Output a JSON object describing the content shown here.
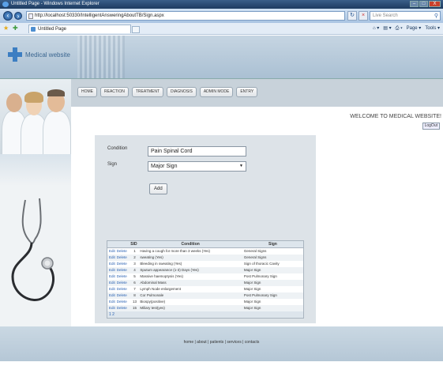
{
  "window": {
    "title": "Untitled Page - Windows Internet Explorer",
    "minimize": "–",
    "maximize": "□",
    "close": "X"
  },
  "addressbar": {
    "url": "http://localhost:50330/IntelligentAnsweringAboutTB/Sign.aspx",
    "search_placeholder": "Live Search"
  },
  "tabs": [
    {
      "label": "Untitled Page"
    }
  ],
  "commandbar": {
    "items": [
      "⌂ ▾",
      "▤ ▾",
      "⎙ ▾",
      "Page ▾",
      "Tools ▾"
    ]
  },
  "site": {
    "logo_text": "Medical website",
    "nav": [
      "HOME",
      "REACTION",
      "TREATMENT",
      "DIAGNOSIS",
      "ADMIN MODE",
      "ENTRY"
    ],
    "welcome": "WELCOME TO MEDICAL WEBSITE!",
    "logout": "LogOut"
  },
  "form": {
    "condition_label": "Condition",
    "condition_value": "Pain Spinal Cord",
    "sign_label": "Sign",
    "sign_value": "Major Sign",
    "add_label": "Add"
  },
  "grid": {
    "headers": [
      "",
      "SID",
      "Condition",
      "Sign"
    ],
    "rows": [
      {
        "edit": "Edit",
        "delete": "Delete",
        "sid": "1",
        "condition": "Having a cough for more than 3 weeks (Yes)",
        "sign": "General Signs"
      },
      {
        "edit": "Edit",
        "delete": "Delete",
        "sid": "2",
        "condition": "sweating (Yes)",
        "sign": "General Signs"
      },
      {
        "edit": "Edit",
        "delete": "Delete",
        "sid": "3",
        "condition": "Bleeding in sweating (Yes)",
        "sign": "Sign of thoracic Cavity"
      },
      {
        "edit": "Edit",
        "delete": "Delete",
        "sid": "4",
        "condition": "Sputum appearance (1-3) Days (Yes)",
        "sign": "Major Sign"
      },
      {
        "edit": "Edit",
        "delete": "Delete",
        "sid": "5",
        "condition": "Massive haemoptysis (Yes)",
        "sign": "Post Pulmonary Sign"
      },
      {
        "edit": "Edit",
        "delete": "Delete",
        "sid": "6",
        "condition": "Abdominal Mass",
        "sign": "Major Sign"
      },
      {
        "edit": "Edit",
        "delete": "Delete",
        "sid": "7",
        "condition": "Lymph Node enlargement",
        "sign": "Major Sign"
      },
      {
        "edit": "Edit",
        "delete": "Delete",
        "sid": "8",
        "condition": "Cor Pulmonale",
        "sign": "Post Pulmonary Sign"
      },
      {
        "edit": "Edit",
        "delete": "Delete",
        "sid": "13",
        "condition": "Biospy(positive)",
        "sign": "Major Sign"
      },
      {
        "edit": "Edit",
        "delete": "Delete",
        "sid": "15",
        "condition": "Miliary test(yes)",
        "sign": "Major Sign"
      }
    ],
    "pager": "1 2"
  },
  "footer": {
    "links": "home | about | patients | services | contacts"
  }
}
